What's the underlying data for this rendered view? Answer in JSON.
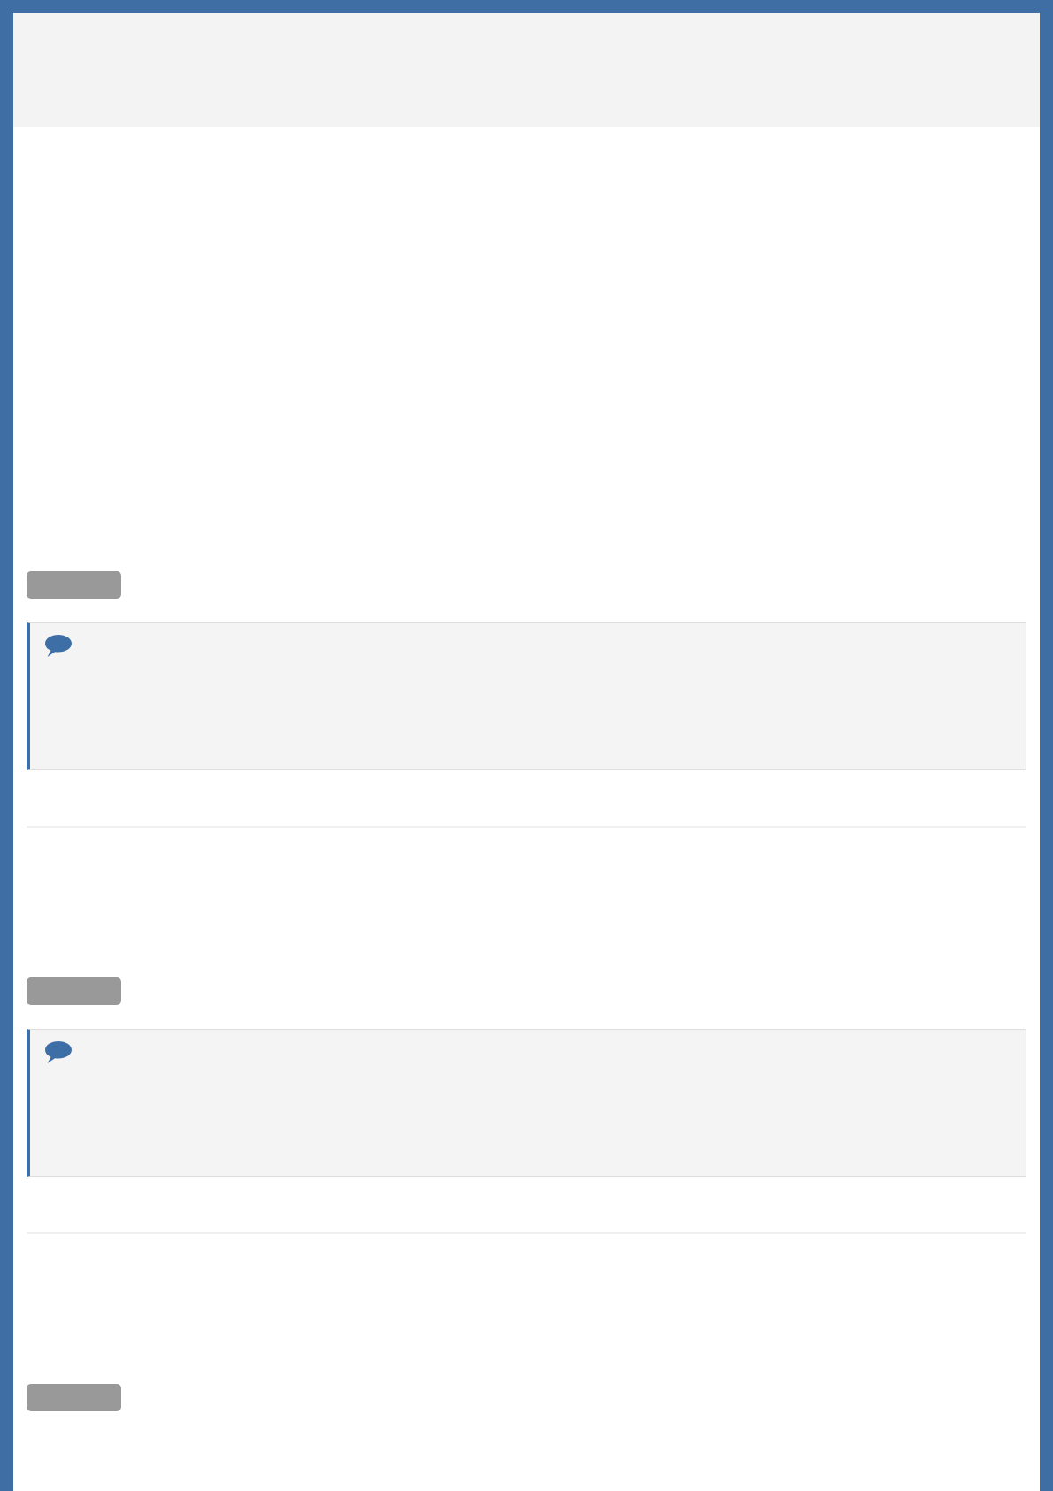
{
  "posts": [
    {
      "comment": true
    },
    {
      "comment": true
    },
    {
      "comment": false
    }
  ]
}
